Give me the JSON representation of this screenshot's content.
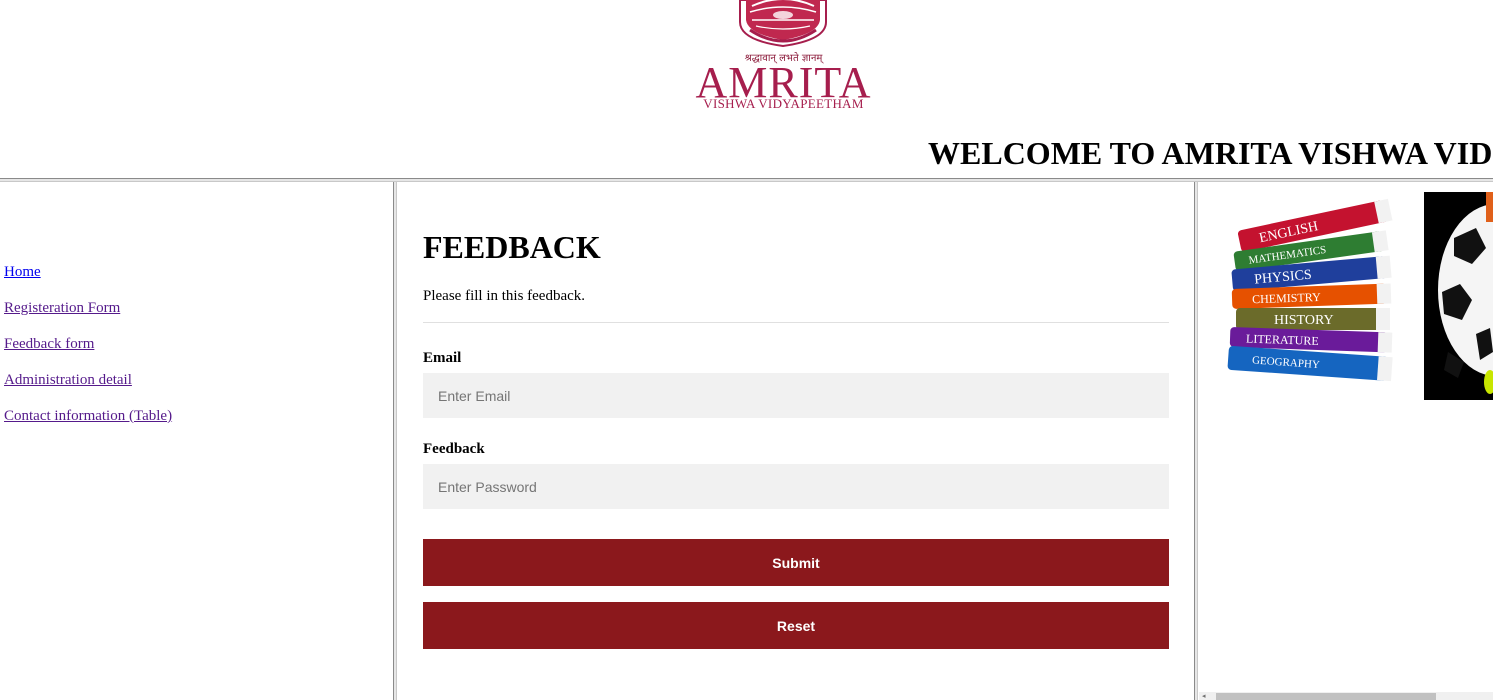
{
  "header": {
    "logo": {
      "hindi_motto": "श्रद्धावान् लभते ज्ञानम्",
      "name": "AMRITA",
      "subtitle": "VISHWA VIDYAPEETHAM",
      "color": "#a61e4d"
    },
    "welcome_text": "WELCOME TO AMRITA VISHWA VID"
  },
  "nav": {
    "items": [
      {
        "label": "Home",
        "visited": false
      },
      {
        "label": "Registeration Form",
        "visited": true
      },
      {
        "label": "Feedback form",
        "visited": true
      },
      {
        "label": "Administration detail",
        "visited": true
      },
      {
        "label": "Contact information (Table)",
        "visited": true
      }
    ]
  },
  "form": {
    "title": "FEEDBACK",
    "intro": "Please fill in this feedback.",
    "email_label": "Email",
    "email_placeholder": "Enter Email",
    "email_value": "",
    "feedback_label": "Feedback",
    "feedback_placeholder": "Enter Password",
    "feedback_value": "",
    "submit_label": "Submit",
    "reset_label": "Reset",
    "button_color": "#8b181c"
  },
  "images": {
    "books": [
      "ENGLISH",
      "MATHEMATICS",
      "PHYSICS",
      "CHEMISTRY",
      "HISTORY",
      "LITERATURE",
      "GEOGRAPHY"
    ],
    "ball": "soccer-ball"
  }
}
